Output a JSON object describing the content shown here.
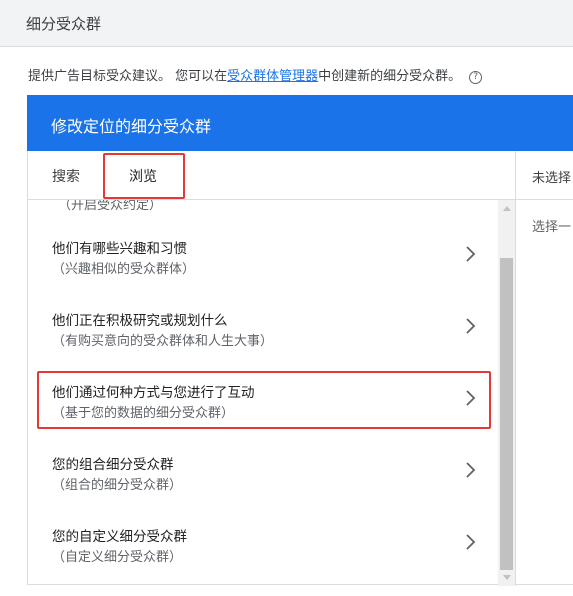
{
  "header": {
    "title": "细分受众群"
  },
  "intro": {
    "text_before": "提供广告目标受众建议。 您可以在",
    "link": "受众群体管理器",
    "text_after": "中创建新的细分受众群。",
    "help_icon": "?"
  },
  "dialog": {
    "title": "修改定位的细分受众群",
    "tabs": [
      {
        "label": "搜索"
      },
      {
        "label": "浏览"
      }
    ],
    "selected_tab": "浏览",
    "right_pane": {
      "header": "未选择",
      "body": "选择一"
    },
    "partial_item_text": "（开启受众约定）",
    "items": [
      {
        "title": "他们有哪些兴趣和习惯",
        "subtitle": "（兴趣相似的受众群体）"
      },
      {
        "title": "他们正在积极研究或规划什么",
        "subtitle": "（有购买意向的受众群体和人生大事）"
      },
      {
        "title": "他们通过何种方式与您进行了互动",
        "subtitle": "（基于您的数据的细分受众群）"
      },
      {
        "title": "您的组合细分受众群",
        "subtitle": "（组合的细分受众群）"
      },
      {
        "title": "您的自定义细分受众群",
        "subtitle": "（自定义细分受众群）"
      }
    ]
  },
  "colors": {
    "accent": "#1a73e8",
    "highlight": "#e53935"
  }
}
